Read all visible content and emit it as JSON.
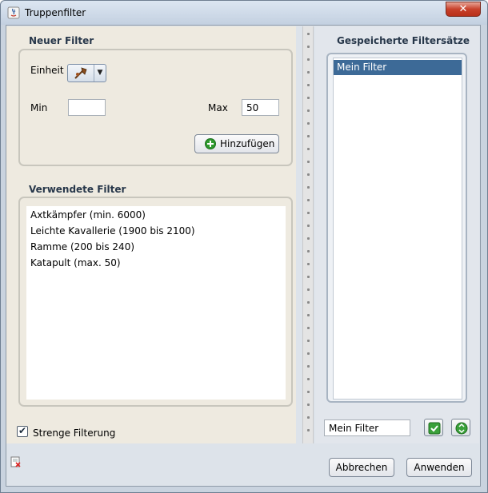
{
  "window": {
    "title": "Truppenfilter",
    "close_symbol": "✕"
  },
  "new_filter": {
    "title": "Neuer Filter",
    "unit_label": "Einheit",
    "unit_icon": "axe-icon",
    "min_label": "Min",
    "min_value": "",
    "max_label": "Max",
    "max_value": "50",
    "add_button": "Hinzufügen"
  },
  "used_filters": {
    "title": "Verwendete Filter",
    "items": [
      "Axtkämpfer (min. 6000)",
      "Leichte Kavallerie (1900 bis 2100)",
      "Ramme (200 bis 240)",
      "Katapult (max. 50)"
    ]
  },
  "strict": {
    "label": "Strenge Filterung",
    "checked": true
  },
  "saved": {
    "title": "Gespeicherte Filtersätze",
    "items": [
      "Mein Filter"
    ],
    "name_value": "Mein Filter"
  },
  "buttons": {
    "cancel": "Abbrechen",
    "apply": "Anwenden"
  },
  "colors": {
    "accent_selection": "#3d6a97",
    "group_title": "#27374a",
    "add_icon": "#2e9a2e"
  }
}
